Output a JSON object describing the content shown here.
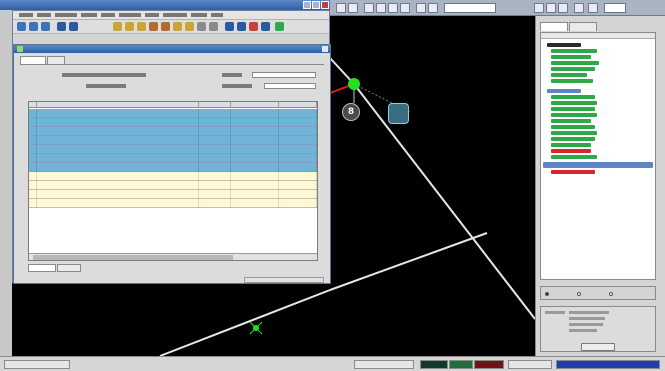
{
  "titlebar": {},
  "menubar": {},
  "dialog": {
    "tabs": [
      "",
      ""
    ],
    "fields": [
      {
        "label": "",
        "value": ""
      },
      {
        "label": "",
        "value": ""
      }
    ],
    "table": {
      "columns": [
        "",
        "",
        "",
        "",
        ""
      ],
      "rows": [
        {
          "cells": [
            "",
            "",
            "",
            "",
            ""
          ],
          "style": "blue"
        },
        {
          "cells": [
            "",
            "",
            "",
            "",
            ""
          ],
          "style": "blue"
        },
        {
          "cells": [
            "",
            "",
            "",
            "",
            ""
          ],
          "style": "blue"
        },
        {
          "cells": [
            "",
            "",
            "",
            "",
            ""
          ],
          "style": "blue"
        },
        {
          "cells": [
            "",
            "",
            "",
            "",
            ""
          ],
          "style": "blue"
        },
        {
          "cells": [
            "",
            "",
            "",
            "",
            ""
          ],
          "style": "blue"
        },
        {
          "cells": [
            "",
            "",
            "",
            "",
            ""
          ],
          "style": "blue"
        },
        {
          "cells": [
            "",
            "",
            "",
            "",
            ""
          ],
          "style": "yellow"
        },
        {
          "cells": [
            "",
            "",
            "",
            "",
            ""
          ],
          "style": "yellow"
        },
        {
          "cells": [
            "",
            "",
            "",
            "",
            ""
          ],
          "style": "yellow"
        },
        {
          "cells": [
            "",
            "",
            "",
            "",
            ""
          ],
          "style": "yellow"
        }
      ]
    },
    "bottom_tabs": [
      "",
      ""
    ]
  },
  "map": {
    "node_number": "8"
  },
  "right_panel": {
    "tabs": [
      "",
      ""
    ],
    "tree": [],
    "filter": {
      "options": [
        "",
        "",
        ""
      ]
    },
    "assign": {
      "rows": [],
      "button": ""
    }
  },
  "statusbar": {},
  "colors": {
    "titlebar": "#2f5ea3",
    "map_background": "#000000",
    "route_line": "#e6e6e6",
    "node_green": "#22e11f",
    "row_blue": "#6fb4d6",
    "row_yellow": "#fff8d8",
    "tree_green": "#2fa84a",
    "tree_red": "#d9262a",
    "tree_selected": "#5a86c4",
    "badge_green": "#1f6e3a",
    "badge_red": "#6d1515",
    "status_blue": "#1f3ea8"
  },
  "icons": [
    "dialog-icon",
    "node-icon",
    "equipment-icon",
    "sync-icon",
    "up-icon"
  ]
}
